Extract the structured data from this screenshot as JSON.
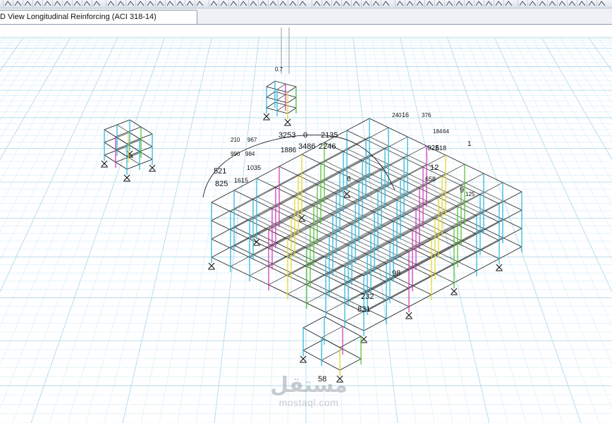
{
  "window": {
    "tab_title": "D View  Longitudinal Reinforcing  (ACI 318-14)"
  },
  "toolbar": {
    "icons": [
      "draw-frame-icon",
      "draw-arrow-icon",
      "select-icon",
      "snap-icon",
      "assign-icon",
      "rebar-icon",
      "release-icon",
      "grid-icon",
      "display-icon",
      "design-icon"
    ]
  },
  "model": {
    "view_mode": "3D",
    "display": "Longitudinal Reinforcing",
    "design_code": "ACI 318-14",
    "design_labels": [
      {
        "text": "0.7"
      },
      {
        "text": "16"
      },
      {
        "text": "240"
      },
      {
        "text": "376"
      },
      {
        "text": "3253"
      },
      {
        "text": "0"
      },
      {
        "text": "2135"
      },
      {
        "text": "210"
      },
      {
        "text": "967"
      },
      {
        "text": "3486"
      },
      {
        "text": "2246"
      },
      {
        "text": "184"
      },
      {
        "text": "64"
      },
      {
        "text": "990"
      },
      {
        "text": "984"
      },
      {
        "text": "1886"
      },
      {
        "text": "1035"
      },
      {
        "text": "925"
      },
      {
        "text": "618"
      },
      {
        "text": "521"
      },
      {
        "text": "825"
      },
      {
        "text": "1615"
      },
      {
        "text": "12"
      },
      {
        "text": "658"
      },
      {
        "text": "9"
      },
      {
        "text": "125"
      },
      {
        "text": "6"
      },
      {
        "text": "98"
      },
      {
        "text": "232"
      },
      {
        "text": "831"
      },
      {
        "text": "58"
      },
      {
        "text": "1"
      }
    ]
  },
  "watermark": {
    "arabic": "مستقل",
    "latin": "mostaql.com"
  },
  "colors": {
    "grid_line": "#a9d4ea",
    "grid_minor": "#d6ecf7",
    "frame_line": "#1a1a1a",
    "column_cyan": "#34b8d8",
    "column_magenta": "#d13fb6",
    "column_yellow": "#e3d82e",
    "column_green": "#59c23a",
    "tab_bg": "#ffffff",
    "toolbar_bg": "#dde3ea"
  }
}
